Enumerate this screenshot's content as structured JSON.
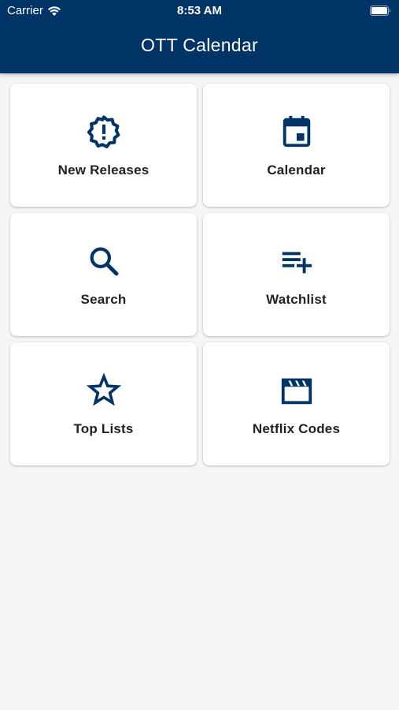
{
  "status_bar": {
    "carrier": "Carrier",
    "time": "8:53 AM"
  },
  "header": {
    "title": "OTT Calendar",
    "color": "#003366"
  },
  "tiles": [
    {
      "label": "New Releases",
      "icon": "new-releases-icon"
    },
    {
      "label": "Calendar",
      "icon": "calendar-icon"
    },
    {
      "label": "Search",
      "icon": "search-icon"
    },
    {
      "label": "Watchlist",
      "icon": "playlist-add-icon"
    },
    {
      "label": "Top Lists",
      "icon": "star-outline-icon"
    },
    {
      "label": "Netflix Codes",
      "icon": "movie-clapper-icon"
    }
  ],
  "colors": {
    "accent": "#003366",
    "background": "#f5f5f5",
    "tile": "#ffffff"
  }
}
